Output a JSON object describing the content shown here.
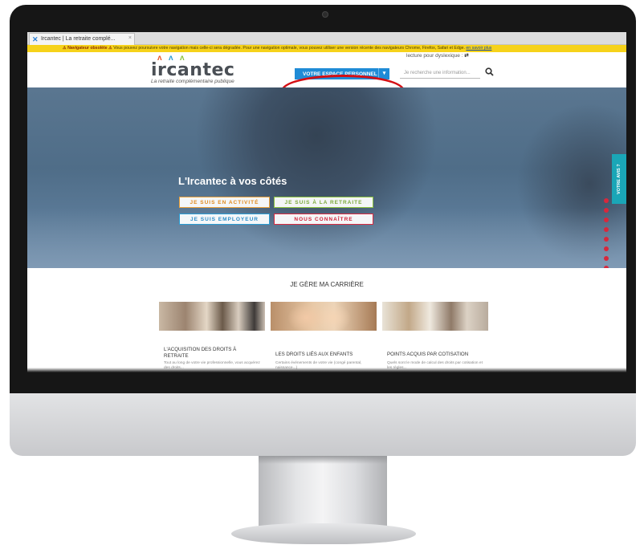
{
  "browser": {
    "tab_title": "Ircantec | La retraite complé...",
    "tab_close": "×",
    "tab_favicon": "✕"
  },
  "warning": {
    "label": "⚠ Navigateur obsolète ⚠",
    "text": " Vous pouvez poursuivre votre navigation mais celle-ci sera dégradée. Pour une navigation optimale, vous pouvez utiliser une version récente des navigateurs Chrome, Firefox, Safari et Edge. ",
    "link": "en savoir plus"
  },
  "header": {
    "logo_text": "ircantec",
    "tagline": "La retraite complémentaire publique",
    "espace_button": "VOTRE ESPACE PERSONNEL",
    "dyslexia": "lecture pour dyslexique :",
    "dyslexia_toggle": "⇄",
    "search_placeholder": "Je recherche une information...",
    "search_icon": "search-icon"
  },
  "hero": {
    "title": "L'Ircantec à vos côtés",
    "buttons": [
      "JE SUIS EN ACTIVITÉ",
      "JE SUIS À LA RETRAITE",
      "JE SUIS EMPLOYEUR",
      "NOUS CONNAÎTRE"
    ],
    "feedback_tab": "VOTRE AVIS ?"
  },
  "section": {
    "title": "JE GÈRE MA CARRIÈRE",
    "cards": [
      {
        "title": "L'ACQUISITION DES DROITS À RETRAITE",
        "text": "Tout au long de votre vie professionnelle, vous acquérez des droits..."
      },
      {
        "title": "LES DROITS LIÉS AUX ENFANTS",
        "text": "Certains événements de votre vie (congé parental, naissance...)"
      },
      {
        "title": "POINTS ACQUIS PAR COTISATION",
        "text": "Quels sont le mode de calcul des droits par cotisation et les règles..."
      }
    ]
  },
  "colors": {
    "espace_blue": "#1f8bd6",
    "annotation_red": "#d40f14",
    "warning_yellow": "#f6d21a",
    "orange": "#e9a13b",
    "green": "#8cc33f",
    "blue": "#2a9dd4",
    "red": "#d92a40",
    "feedback_teal": "#1aa6b7"
  }
}
